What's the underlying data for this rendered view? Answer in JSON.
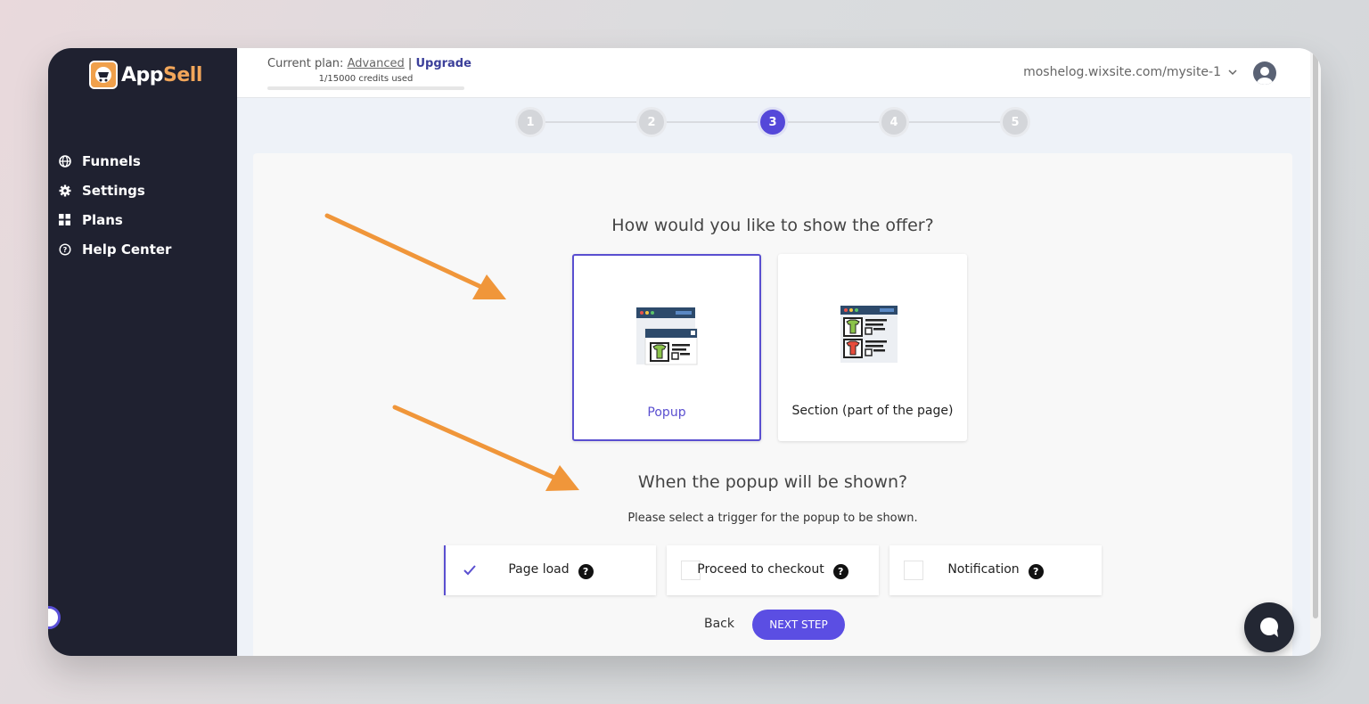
{
  "app": {
    "logo_app": "App",
    "logo_sell": "Sell"
  },
  "sidebar": {
    "items": [
      {
        "label": "Funnels",
        "icon": "globe-icon"
      },
      {
        "label": "Settings",
        "icon": "gear-icon"
      },
      {
        "label": "Plans",
        "icon": "grid-icon"
      },
      {
        "label": "Help Center",
        "icon": "help-circle-icon"
      }
    ]
  },
  "header": {
    "plan_prefix": "Current plan:",
    "plan_name": "Advanced",
    "separator": "|",
    "upgrade": "Upgrade",
    "credits": "1/15000 credits used",
    "credits_used_fraction": 6.67e-05,
    "site": "moshelog.wixsite.com/mysite-1"
  },
  "stepper": {
    "steps": [
      "1",
      "2",
      "3",
      "4",
      "5"
    ],
    "active": 3
  },
  "main": {
    "question1": "How would you like to show the offer?",
    "options": [
      {
        "label": "Popup",
        "selected": true
      },
      {
        "label": "Section (part of the page)",
        "selected": false
      }
    ],
    "question2": "When the popup will be shown?",
    "question2_sub": "Please select a trigger for the popup to be shown.",
    "triggers": [
      {
        "label": "Page load",
        "selected": true
      },
      {
        "label": "Proceed to checkout",
        "selected": false
      },
      {
        "label": "Notification",
        "selected": false
      }
    ],
    "help_glyph": "?",
    "back": "Back",
    "next": "NEXT STEP"
  },
  "colors": {
    "accent": "#5b4ee3",
    "sidebar": "#1f2130",
    "arrow": "#f0963a",
    "logo": "#f0a04b"
  }
}
